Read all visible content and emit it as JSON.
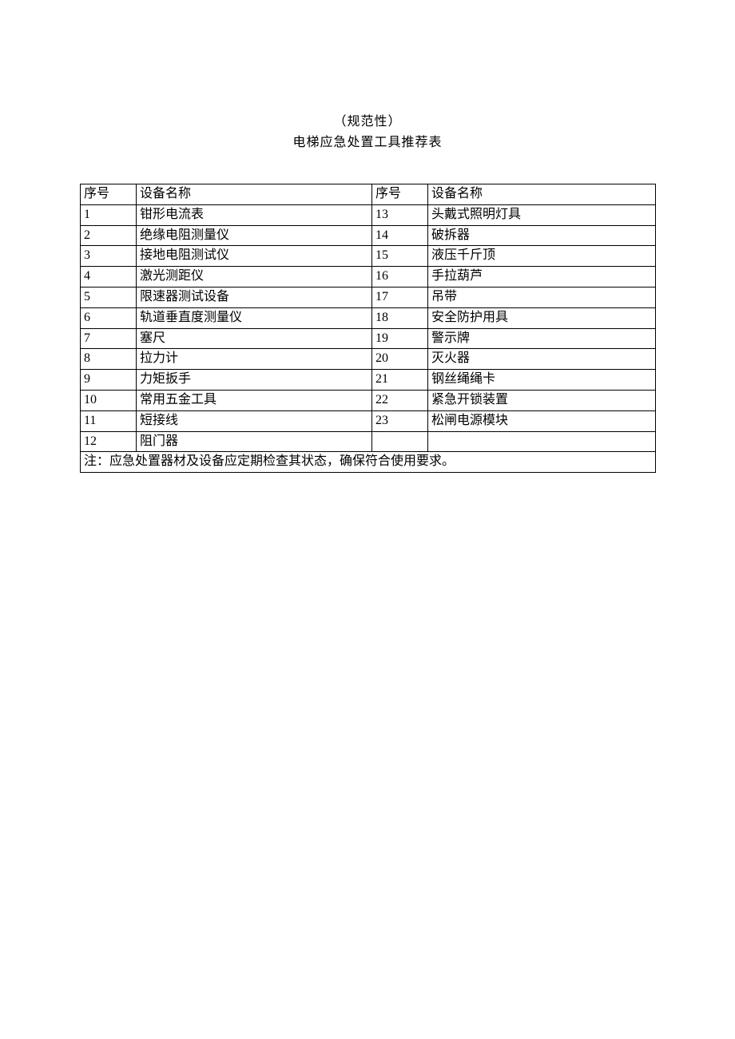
{
  "header": {
    "line1": "（规范性）",
    "line2": "电梯应急处置工具推荐表"
  },
  "table": {
    "columns": {
      "seq_label_1": "序号",
      "name_label_1": "设备名称",
      "seq_label_2": "序号",
      "name_label_2": "设备名称"
    },
    "rows": [
      {
        "seq1": "1",
        "name1": "钳形电流表",
        "seq2": "13",
        "name2": "头戴式照明灯具"
      },
      {
        "seq1": "2",
        "name1": "绝缘电阻测量仪",
        "seq2": "14",
        "name2": "破拆器"
      },
      {
        "seq1": "3",
        "name1": "接地电阻测试仪",
        "seq2": "15",
        "name2": "液压千斤顶"
      },
      {
        "seq1": "4",
        "name1": "激光测距仪",
        "seq2": "16",
        "name2": "手拉葫芦"
      },
      {
        "seq1": "5",
        "name1": "限速器测试设备",
        "seq2": "17",
        "name2": "吊带"
      },
      {
        "seq1": "6",
        "name1": "轨道垂直度测量仪",
        "seq2": "18",
        "name2": "安全防护用具"
      },
      {
        "seq1": "7",
        "name1": "塞尺",
        "seq2": "19",
        "name2": "警示牌"
      },
      {
        "seq1": "8",
        "name1": "拉力计",
        "seq2": "20",
        "name2": "灭火器"
      },
      {
        "seq1": "9",
        "name1": "力矩扳手",
        "seq2": "21",
        "name2": "钢丝绳绳卡"
      },
      {
        "seq1": "10",
        "name1": "常用五金工具",
        "seq2": "22",
        "name2": "紧急开锁装置"
      },
      {
        "seq1": "11",
        "name1": "短接线",
        "seq2": "23",
        "name2": "松闸电源模块"
      },
      {
        "seq1": "12",
        "name1": "阻门器",
        "seq2": "",
        "name2": ""
      }
    ],
    "footnote": "注：应急处置器材及设备应定期检查其状态，确保符合使用要求。"
  }
}
